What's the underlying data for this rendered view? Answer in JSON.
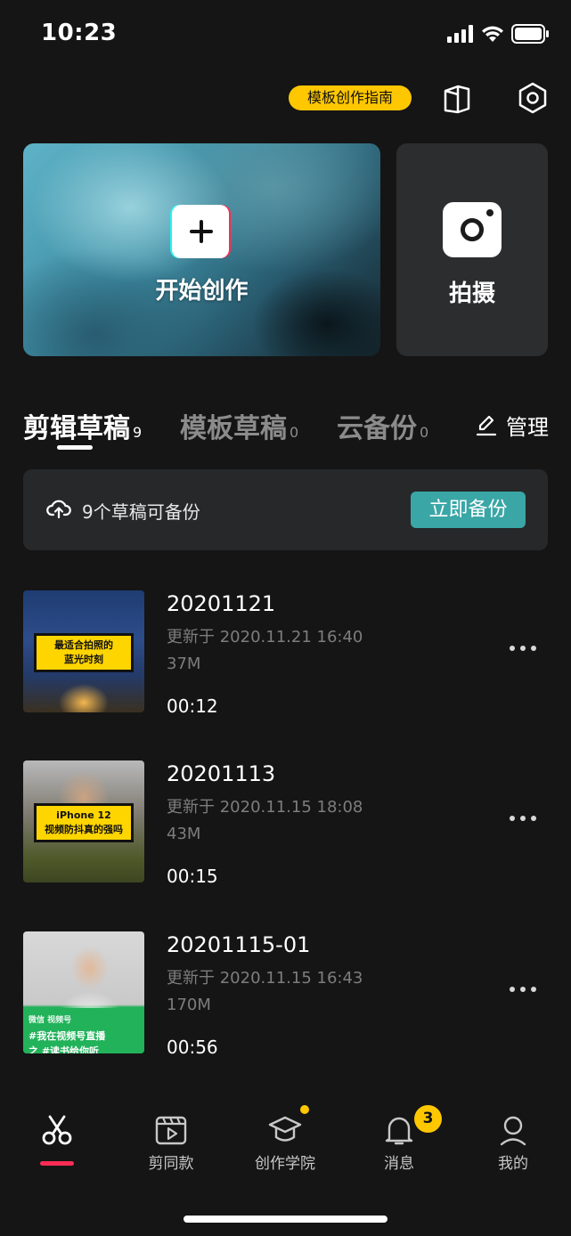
{
  "status_bar": {
    "time": "10:23"
  },
  "toolbar": {
    "guide_label": "模板创作指南"
  },
  "create": {
    "label": "开始创作"
  },
  "shoot": {
    "label": "拍摄"
  },
  "tabs": [
    {
      "label": "剪辑草稿",
      "count": "9"
    },
    {
      "label": "模板草稿",
      "count": "0"
    },
    {
      "label": "云备份",
      "count": "0"
    }
  ],
  "manage_label": "管理",
  "backup": {
    "text": "9个草稿可备份",
    "button": "立即备份"
  },
  "drafts": [
    {
      "title": "20201121",
      "updated": "更新于 2020.11.21 16:40",
      "size": "37M",
      "duration": "00:12",
      "thumb_text": [
        "最适合拍照的",
        "蓝光时刻"
      ]
    },
    {
      "title": "20201113",
      "updated": "更新于 2020.11.15 18:08",
      "size": "43M",
      "duration": "00:15",
      "thumb_text": [
        "iPhone 12",
        "视频防抖真的强吗"
      ]
    },
    {
      "title": "20201115-01",
      "updated": "更新于 2020.11.15 16:43",
      "size": "170M",
      "duration": "00:56",
      "thumb_text": [
        "微信  视频号",
        "#我在视频号直播",
        "之 #读书给你听"
      ]
    }
  ],
  "bottom_nav": [
    {
      "label": "",
      "icon": "scissors-icon"
    },
    {
      "label": "剪同款",
      "icon": "template-video-icon"
    },
    {
      "label": "创作学院",
      "icon": "graduation-cap-icon"
    },
    {
      "label": "消息",
      "icon": "bell-icon"
    },
    {
      "label": "我的",
      "icon": "profile-icon"
    }
  ],
  "message_badge": "3",
  "colors": {
    "background": "#151515",
    "accent_yellow": "#ffc700",
    "backup_button": "#3aa6a6",
    "active_tab_indicator": "#fe2c55"
  }
}
